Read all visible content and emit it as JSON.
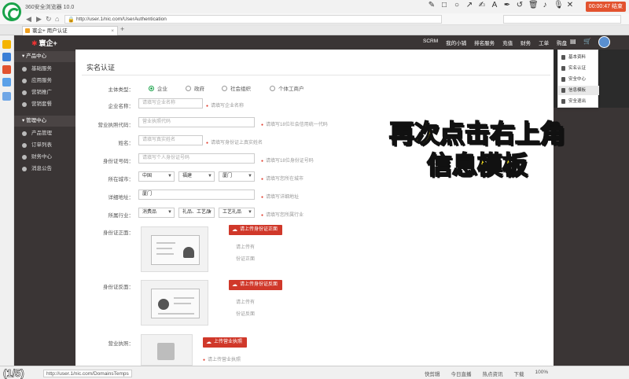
{
  "browser": {
    "title": "360安全浏览器 10.0",
    "url": "http://user.1/nic.com/UserAuthentication",
    "tab_label": "寰企+ 用户认证",
    "new_tab": "+",
    "record_timer": "00:00:47 结束"
  },
  "header": {
    "brand": "寰企+",
    "nav": [
      "SCRM",
      "我的小铺",
      "排名服务",
      "充值",
      "财务",
      "工单",
      "购盘"
    ]
  },
  "sidebar": {
    "items": [
      {
        "label": "产品中心",
        "section": true
      },
      {
        "label": "基础服务"
      },
      {
        "label": "应用服务"
      },
      {
        "label": "营销推广"
      },
      {
        "label": "营销套餐"
      },
      {
        "label": "管理中心",
        "section": true
      },
      {
        "label": "产品管理"
      },
      {
        "label": "订单列表"
      },
      {
        "label": "财务中心"
      },
      {
        "label": "消息公告"
      }
    ]
  },
  "dropdown": {
    "items": [
      "基本资料",
      "实名认证",
      "安全中心",
      "信息模板",
      "安全退出"
    ],
    "hover_index": 3
  },
  "form": {
    "title": "实名认证",
    "subject_label": "主体类型：",
    "subject_options": [
      "企业",
      "政府",
      "社会组织",
      "个体工商户"
    ],
    "company_label": "企业名称：",
    "company_placeholder": "请填写企业名称",
    "company_hint": "请填写企业名称",
    "license_label": "营业执照代码：",
    "license_placeholder": "营业执照代码",
    "license_hint": "请填写18位社会信用统一代码",
    "name_label": "姓名：",
    "name_placeholder": "请填写真实姓名",
    "name_hint": "请填写身份证上真实姓名",
    "idnum_label": "身份证号码：",
    "idnum_placeholder": "请填写个人身份证号码",
    "idnum_hint": "请填写18位身份证号码",
    "city_label": "所在城市：",
    "city_values": [
      "中国",
      "福建",
      "厦门"
    ],
    "city_hint": "请填写您所在城市",
    "address_label": "详细地址：",
    "address_value": "厦门",
    "address_hint": "请填写详细地址",
    "industry_label": "所属行业：",
    "industry_values": [
      "消费品",
      "礼品、工艺品",
      "工艺礼品"
    ],
    "industry_hint": "请填写您所属行业",
    "id_front_label": "身份证正面：",
    "id_front_button": "请上传身份证正面",
    "id_front_note1": "请上传有",
    "id_front_note2": "份证正面",
    "id_back_label": "身份证反面：",
    "id_back_button": "请上传身份证反面",
    "id_back_note1": "请上传有",
    "id_back_note2": "份证反面",
    "biz_label": "营业执照：",
    "biz_button": "上传营业执照",
    "biz_note": "请上传营业执照"
  },
  "caption": {
    "line1": "再次点击右上角",
    "line2": "信息模板"
  },
  "status": {
    "page_count": "(1/5)",
    "url": "http://user.1/nic.com/DomainsTemps",
    "items": [
      "快剪辑",
      "今日直播",
      "热点资讯",
      "下载",
      "100%"
    ]
  },
  "colors": {
    "dark": "#3a3535",
    "accent": "#d0382a",
    "green": "#1aa34a",
    "caption": "#ffe81a"
  }
}
